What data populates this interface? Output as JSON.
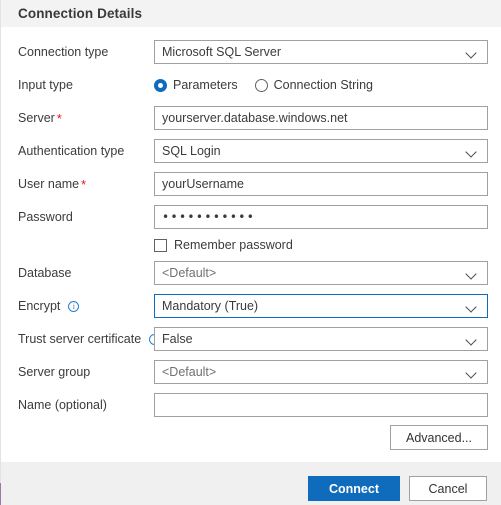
{
  "dialog": {
    "title": "Connection Details"
  },
  "fields": {
    "connection_type": {
      "label": "Connection type",
      "value": "Microsoft SQL Server",
      "control": "select",
      "required": false
    },
    "input_type": {
      "label": "Input type",
      "options": [
        {
          "label": "Parameters",
          "selected": true
        },
        {
          "label": "Connection String",
          "selected": false
        }
      ]
    },
    "server": {
      "label": "Server",
      "value": "yourserver.database.windows.net",
      "control": "text",
      "required": true,
      "required_mark": "*"
    },
    "authentication_type": {
      "label": "Authentication type",
      "value": "SQL Login",
      "control": "select",
      "required": false
    },
    "user_name": {
      "label": "User name",
      "value": "yourUsername",
      "control": "text",
      "required": true,
      "required_mark": "*"
    },
    "password": {
      "label": "Password",
      "value": "•••••••••••",
      "control": "password",
      "required": false
    },
    "remember_password": {
      "label": "Remember password",
      "checked": false
    },
    "database": {
      "label": "Database",
      "value": "<Default>",
      "control": "select",
      "is_placeholder": true
    },
    "encrypt": {
      "label": "Encrypt",
      "value": "Mandatory (True)",
      "control": "select",
      "has_info": true,
      "focused": true
    },
    "trust_server_certificate": {
      "label": "Trust server certificate",
      "value": "False",
      "control": "select",
      "has_info": true
    },
    "server_group": {
      "label": "Server group",
      "value": "<Default>",
      "control": "select",
      "is_placeholder": true
    },
    "name_optional": {
      "label": "Name (optional)",
      "value": "",
      "control": "text"
    }
  },
  "buttons": {
    "advanced": "Advanced...",
    "connect": "Connect",
    "cancel": "Cancel"
  },
  "colors": {
    "accent": "#0f6cbd",
    "required": "#e81123",
    "info_icon": "#2d7dd2",
    "header_bg": "#f3f3f3",
    "footer_bg": "#f0f0f0",
    "border": "#a0a0a0"
  }
}
